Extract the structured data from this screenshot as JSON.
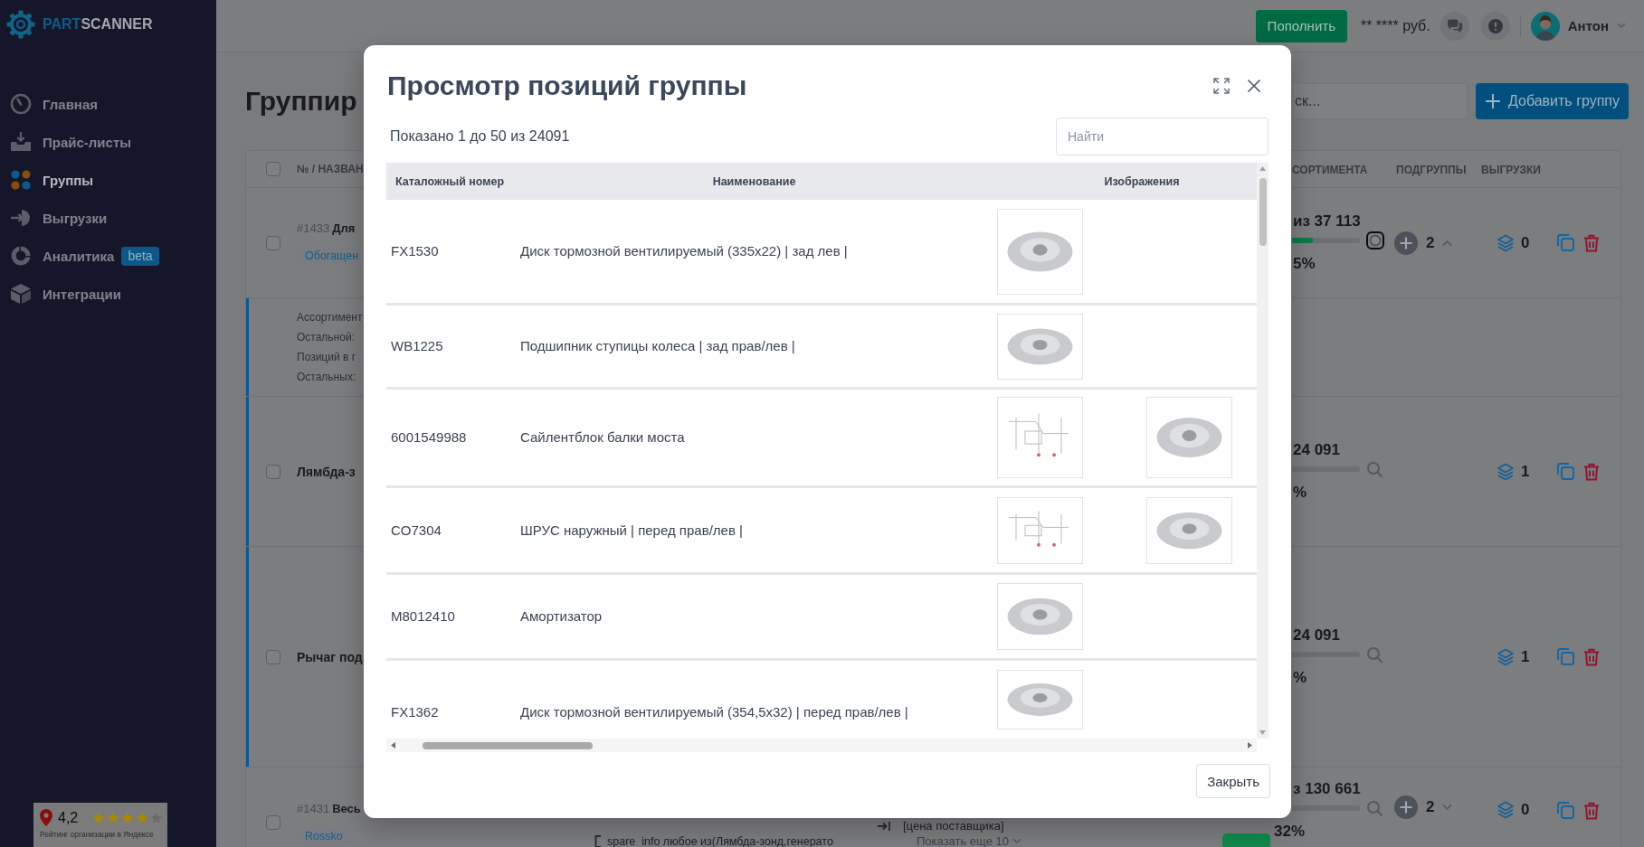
{
  "sidebar": {
    "logo": {
      "accent": "PART",
      "rest": "SCANNER"
    },
    "items": [
      {
        "label": "Главная",
        "selected": false
      },
      {
        "label": "Прайс-листы",
        "selected": false
      },
      {
        "label": "Группы",
        "selected": true
      },
      {
        "label": "Выгрузки",
        "selected": false
      },
      {
        "label": "Аналитика",
        "selected": false,
        "badge": "beta"
      },
      {
        "label": "Интеграции",
        "selected": false
      }
    ]
  },
  "rating": {
    "score": "4,2",
    "stars": 4,
    "caption": "Рейтинг организации в Яндексе"
  },
  "topbar": {
    "topup_button": "Пополнить",
    "balance": "** **** руб.",
    "user": "Антон"
  },
  "page": {
    "title": "Группир",
    "search": {
      "placeholder": "ск..."
    },
    "add_button": "Добавить группу",
    "table": {
      "header_checked": false,
      "columns": [
        "№ / НАЗВАН",
        "СОРТИМЕНТА",
        "ПОДГРУППЫ",
        "ВЫГРУЗКИ"
      ],
      "rows": [
        {
          "checked": false,
          "number": "#1433",
          "name": "Для",
          "tag": "Обогащен",
          "count": "из 37 113",
          "level": 0.3,
          "percent": "5%",
          "search_focused": true,
          "subgroups": "2",
          "expanded": true,
          "exports": "0",
          "details": [
            "Ассортимент",
            "Остальной:",
            "Позиций в г",
            "Остальных:"
          ],
          "children": [
            {
              "checked": false,
              "name": "Лямбда-з",
              "count": "24 091",
              "percent": "%",
              "search_focused": false,
              "exports": "1"
            },
            {
              "checked": false,
              "name": "Рычаг под",
              "count": "24 091",
              "percent": "%",
              "search_focused": false,
              "exports": "1"
            }
          ]
        },
        {
          "checked": false,
          "number": "#1431",
          "name": "Весь",
          "tag": "Rossko",
          "rule": "spare_info любое из(Лямбда-зонд,генерато",
          "price": "[цена поставщика]",
          "more": "Показать еще 10",
          "active": true,
          "count": "з 130 661",
          "percent": "32%",
          "search_focused": false,
          "subgroups": "2",
          "expanded": false,
          "exports": "0"
        }
      ]
    }
  },
  "modal": {
    "title": "Просмотр позиций группы",
    "summary": "Показано 1 до 50 из 24091",
    "search": {
      "placeholder": "Найти"
    },
    "columns": [
      "Каталожный номер",
      "Наименование",
      "Изображения"
    ],
    "rows": [
      {
        "number": "FX1530",
        "name": "Диск тормозной вентилируемый (335x22) | зад лев |",
        "images": [
          {
            "kind": "photo"
          }
        ]
      },
      {
        "number": "WB1225",
        "name": "Подшипник ступицы колеса | зад прав/лев |",
        "images": [
          {
            "kind": "photo"
          }
        ]
      },
      {
        "number": "6001549988",
        "name": "Сайлентблок балки моста",
        "images": [
          {
            "kind": "diagram"
          },
          {
            "kind": "photo"
          }
        ]
      },
      {
        "number": "CO7304",
        "name": "ШРУС наружный | перед прав/лев |",
        "images": [
          {
            "kind": "diagram"
          },
          {
            "kind": "photo"
          }
        ]
      },
      {
        "number": "M8012410",
        "name": "Амортизатор",
        "images": [
          {
            "kind": "photo"
          }
        ]
      },
      {
        "number": "FX1362",
        "name": "Диск тормозной вентилируемый (354,5x32) | перед прав/лев |",
        "images": [
          {
            "kind": "photo"
          }
        ]
      }
    ],
    "close_button": "Закрыть"
  }
}
